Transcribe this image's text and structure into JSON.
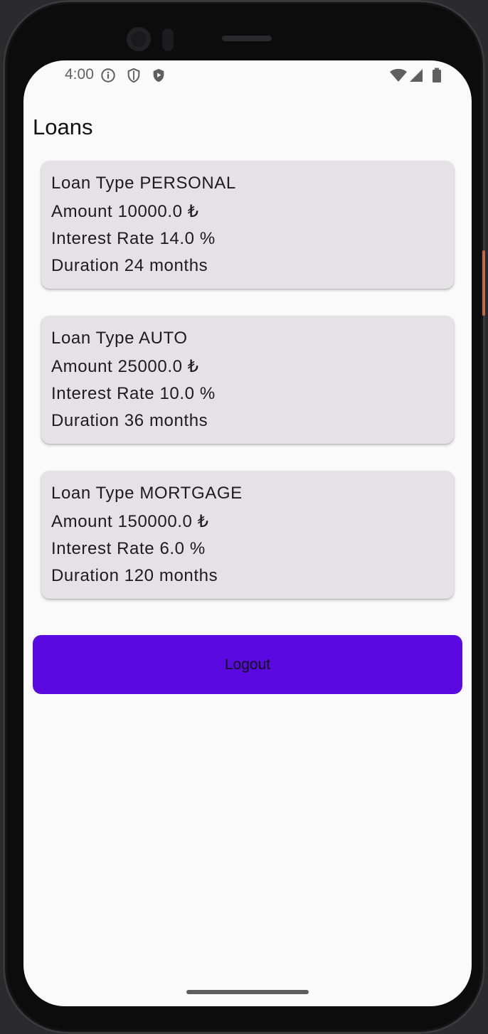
{
  "status_bar": {
    "time": "4:00",
    "icons": [
      "info-icon",
      "shield-outline-icon",
      "shield-play-icon",
      "wifi-icon",
      "signal-icon",
      "battery-icon"
    ]
  },
  "page": {
    "title": "Loans"
  },
  "loans": [
    {
      "type_line": "Loan Type PERSONAL",
      "amount_line": "Amount 10000.0 ₺",
      "rate_line": "Interest Rate 14.0 %",
      "duration_line": "Duration 24 months"
    },
    {
      "type_line": "Loan Type AUTO",
      "amount_line": "Amount 25000.0 ₺",
      "rate_line": "Interest Rate 10.0 %",
      "duration_line": "Duration 36 months"
    },
    {
      "type_line": "Loan Type MORTGAGE",
      "amount_line": "Amount 150000.0 ₺",
      "rate_line": "Interest Rate 6.0 %",
      "duration_line": "Duration 120 months"
    }
  ],
  "actions": {
    "logout_label": "Logout"
  },
  "colors": {
    "accent": "#5a0ae0",
    "card_background": "#e6e0e7",
    "screen_background": "#fafafa"
  }
}
